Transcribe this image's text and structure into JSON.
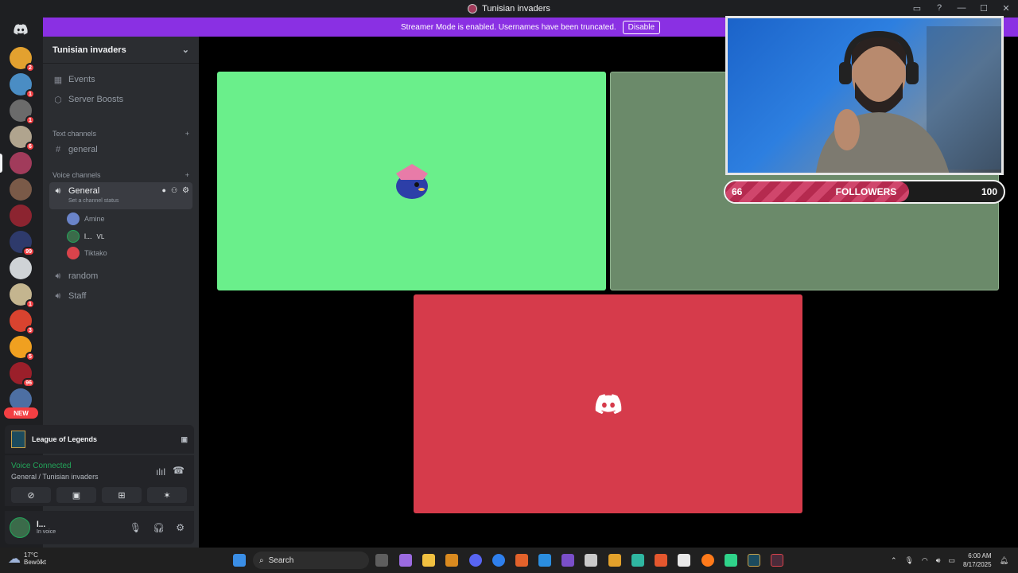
{
  "window": {
    "title": "Tunisian invaders"
  },
  "banner": {
    "text": "Streamer Mode is enabled. Usernames have been truncated.",
    "button": "Disable"
  },
  "guilds": {
    "items": [
      {
        "badge": "2",
        "color": "#e3a12f"
      },
      {
        "badge": "1",
        "color": "#4a8dc4"
      },
      {
        "badge": "1",
        "color": "#6b6b6b"
      },
      {
        "badge": "6",
        "color": "#b0a48e"
      },
      {
        "badge": "",
        "color": "#a13b5b"
      },
      {
        "badge": "",
        "color": "#7a5a48"
      },
      {
        "badge": "",
        "color": "#8c2430"
      },
      {
        "badge": "99",
        "color": "#2e3a6b"
      },
      {
        "badge": "",
        "color": "#cfd3d6"
      },
      {
        "badge": "1",
        "color": "#c4b58f"
      },
      {
        "badge": "3",
        "color": "#d9432f"
      },
      {
        "badge": "5",
        "color": "#f0a020"
      },
      {
        "badge": "96",
        "color": "#9b1f2a"
      },
      {
        "badge": "",
        "color": "#4d6fa3"
      }
    ],
    "new_label": "NEW"
  },
  "server": {
    "name": "Tunisian invaders",
    "events": "Events",
    "boosts": "Server Boosts",
    "text_category": "Text channels",
    "text_channels": [
      "general"
    ],
    "voice_category": "Voice channels",
    "voice_active": "General",
    "voice_status": "Set a channel status",
    "voice_users": [
      {
        "name": "Amine",
        "tag": "",
        "color": "#6a84c9"
      },
      {
        "name": "l...",
        "tag": "VL",
        "color": "#3b6b4a"
      },
      {
        "name": "Tiktako",
        "tag": "",
        "color": "#d9434b"
      }
    ],
    "other_voice": [
      "random",
      "Staff"
    ]
  },
  "activity": {
    "game": "League of Legends"
  },
  "voice": {
    "status": "Voice Connected",
    "location": "General / Tunisian invaders"
  },
  "user": {
    "name": "l...",
    "status": "In voice"
  },
  "overlay": {
    "current": "66",
    "label": "FOLLOWERS",
    "goal": "100",
    "progress": 0.66
  },
  "taskbar": {
    "weather_temp": "17°C",
    "weather_desc": "Bewölkt",
    "search": "Search",
    "time": "6:00 AM",
    "date": "8/17/2025"
  },
  "colors": {
    "tile1": "#6aef8b",
    "tile2": "#6b8a6a",
    "tile3": "#d63b4b",
    "accent": "#5865f2"
  }
}
